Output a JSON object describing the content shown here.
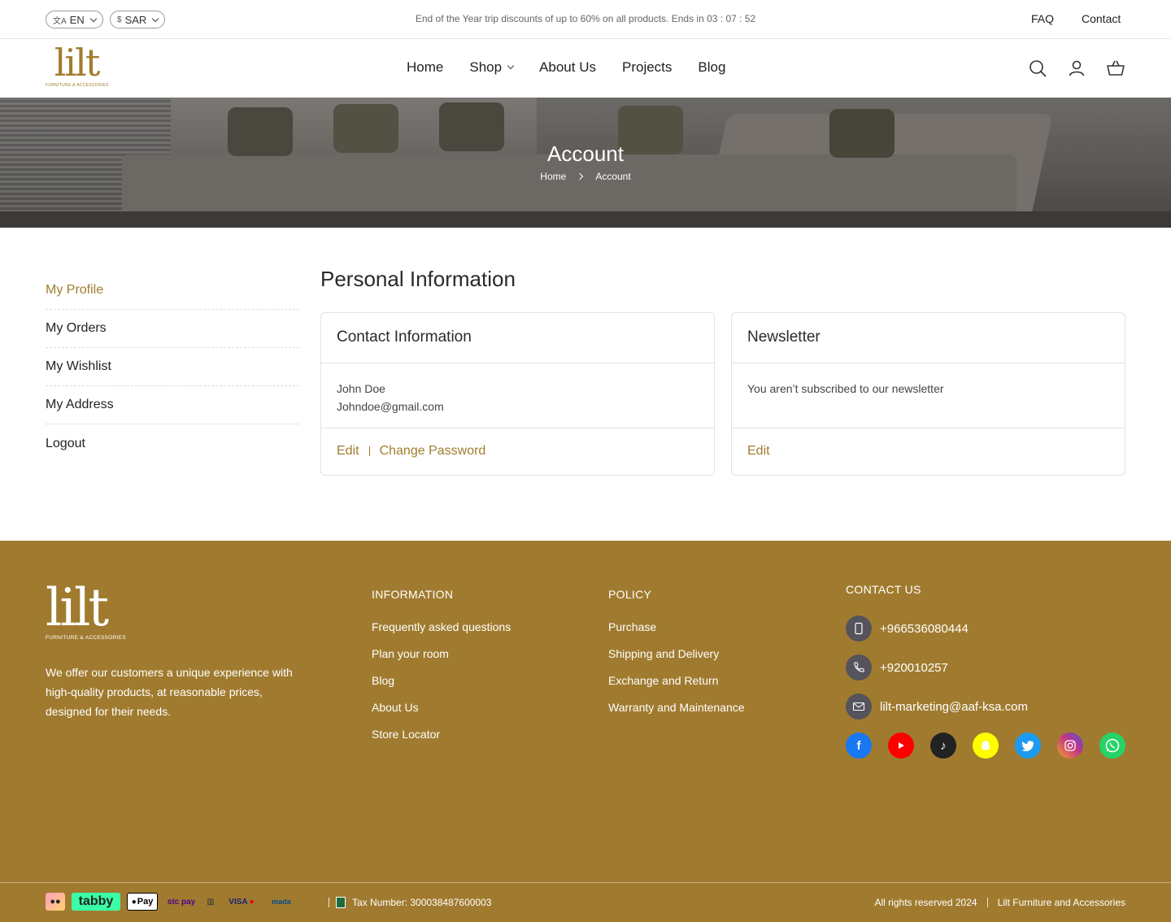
{
  "topbar": {
    "language": "EN",
    "currency": "SAR",
    "promo": "End of the Year trip discounts of up to 60% on all products. Ends in 03 : 07 : 52",
    "faq": "FAQ",
    "contact": "Contact"
  },
  "header": {
    "logo_mark": "lilt",
    "logo_sub": "FURNITURE & ACCESSORIES",
    "nav": [
      "Home",
      "Shop",
      "About Us",
      "Projects",
      "Blog"
    ]
  },
  "hero": {
    "title": "Account",
    "breadcrumb": [
      "Home",
      "Account"
    ]
  },
  "sidebar": {
    "items": [
      "My Profile",
      "My Orders",
      "My Wishlist",
      "My Address",
      "Logout"
    ],
    "active_color": "#a27c2f"
  },
  "main": {
    "title": "Personal Information",
    "contact_card": {
      "title": "Contact Information",
      "name": "John Doe",
      "email": "Johndoe@gmail.com",
      "edit": "Edit",
      "change_password": "Change Password"
    },
    "newsletter_card": {
      "title": "Newsletter",
      "status": "You aren’t subscribed to our newsletter",
      "edit": "Edit"
    }
  },
  "footer": {
    "bg_color": "#a07b2f",
    "logo_mark": "lilt",
    "logo_sub": "FURNITURE & ACCESSORIES",
    "description": "We offer our customers a unique experience with high-quality products, at reasonable prices, designed for their needs.",
    "information": {
      "heading": "INFORMATION",
      "links": [
        "Frequently asked questions",
        "Plan your room",
        "Blog",
        "About Us",
        "Store Locator"
      ]
    },
    "policy": {
      "heading": "POLICY",
      "links": [
        "Purchase",
        "Shipping and Delivery",
        "Exchange and Return",
        "Warranty and Maintenance"
      ]
    },
    "contact": {
      "heading": "CONTACT US",
      "mobile": "+966536080444",
      "phone": "+920010257",
      "email": "lilt-marketing@aaf-ksa.com"
    },
    "socials": [
      {
        "icon": "facebook-icon",
        "color": "#1877f2"
      },
      {
        "icon": "youtube-icon",
        "color": "#ff0000"
      },
      {
        "icon": "tiktok-icon",
        "color": "#222222"
      },
      {
        "icon": "snapchat-icon",
        "color": "#fffc00"
      },
      {
        "icon": "twitter-icon",
        "color": "#1d9bf0"
      },
      {
        "icon": "instagram-icon",
        "color": "#c13584"
      },
      {
        "icon": "whatsapp-icon",
        "color": "#25d366"
      }
    ],
    "payments": [
      "tabby",
      "Pay",
      "stc pay",
      "VISA",
      "mada"
    ],
    "tax": "Tax Number: 300038487600003",
    "rights": "All rights reserved 2024",
    "company": "Lilt Furniture and Accessories"
  }
}
